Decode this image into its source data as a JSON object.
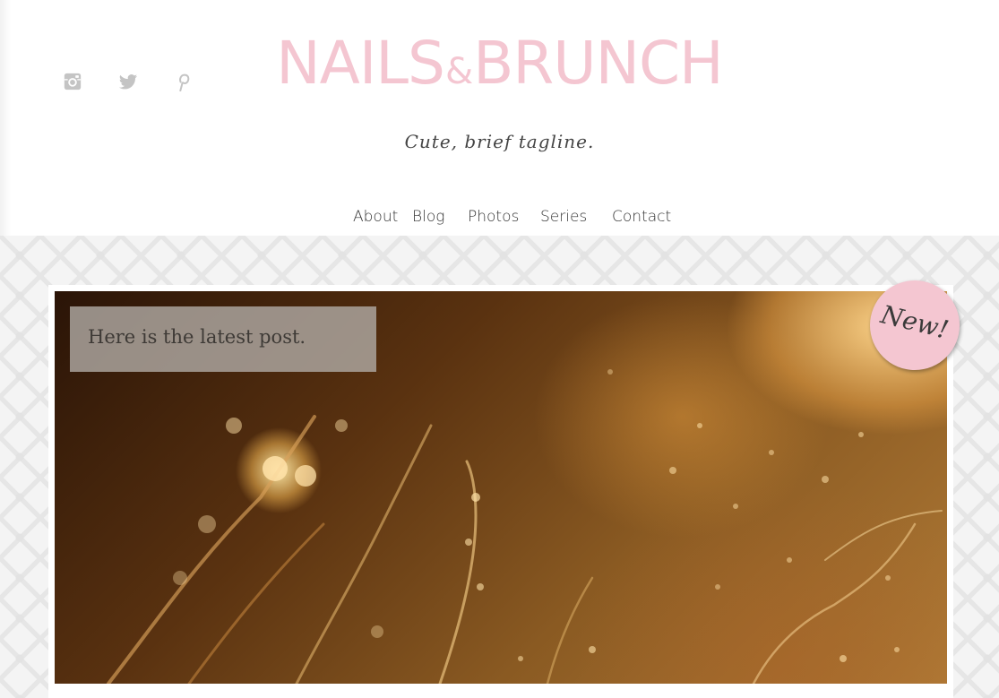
{
  "site": {
    "logo_part1": "NAILS",
    "logo_amp": "&",
    "logo_part2": "BRUNCH",
    "tagline": "Cute, brief tagline."
  },
  "social": [
    {
      "icon": "instagram-icon"
    },
    {
      "icon": "twitter-icon"
    },
    {
      "icon": "pinterest-icon"
    }
  ],
  "nav": {
    "items": [
      {
        "label": "About"
      },
      {
        "label": "Blog"
      },
      {
        "label": "Photos"
      },
      {
        "label": "Series"
      },
      {
        "label": "Contact"
      }
    ]
  },
  "featured": {
    "caption": "Here is the latest post.",
    "badge": "New!"
  },
  "colors": {
    "brand_pink": "#f4c6d1",
    "nav_text": "#333333",
    "icon_gray": "#c4c4c4",
    "caption_bg": "#afa8a2"
  }
}
